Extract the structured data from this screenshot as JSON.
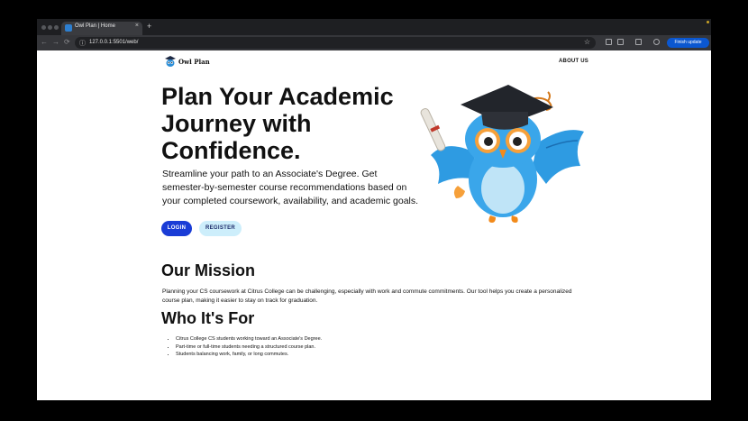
{
  "browser": {
    "tab_title": "Owl Plan | Home",
    "tab_close": "×",
    "new_tab": "+",
    "url": "127.0.0.1:5501/web/",
    "back": "←",
    "forward": "→",
    "reload": "⟳",
    "star": "☆",
    "info": "ⓘ",
    "finish_update": "Finish update"
  },
  "nav": {
    "brand": "Owl Plan",
    "about": "ABOUT US"
  },
  "hero": {
    "title": "Plan Your Academic Journey with Confidence.",
    "subtitle": "Streamline your path to an Associate's Degree. Get semester-by-semester course recommendations based on your completed coursework, availability, and academic goals.",
    "login": "LOGIN",
    "register": "REGISTER"
  },
  "mission": {
    "heading": "Our Mission",
    "text": "Planning your CS coursework at Citrus College can be challenging, especially with work and commute commitments. Our tool helps you create a personalized course plan, making it easier to stay on track for graduation."
  },
  "audience": {
    "heading": "Who It's For",
    "items": [
      "Citrus College CS students working toward an Associate's Degree.",
      "Part-time or full-time students needing a structured course plan.",
      "Students balancing work, family, or long commutes."
    ]
  },
  "colors": {
    "login_bg": "#1a3cd6",
    "register_bg": "#cdeefb",
    "update_button": "#0b57d0"
  }
}
